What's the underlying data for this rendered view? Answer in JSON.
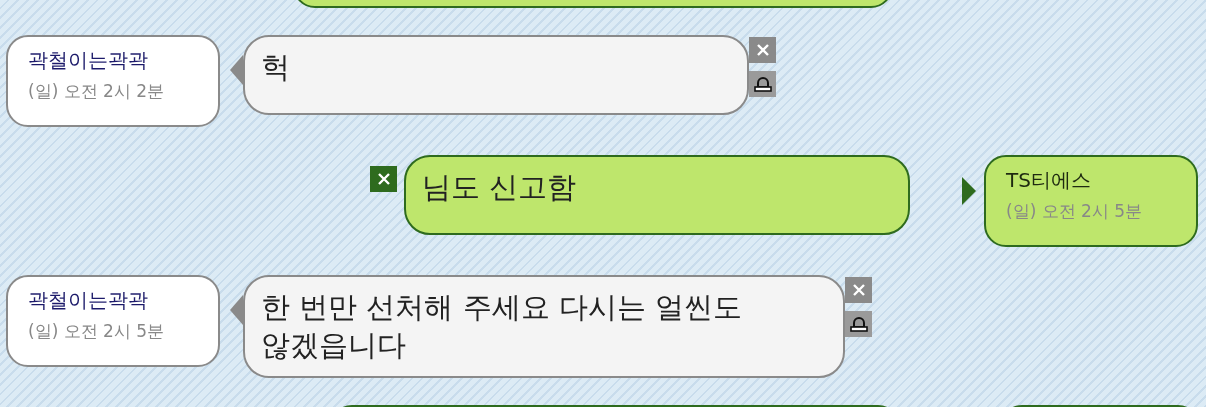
{
  "messages": [
    {
      "kind": "incoming",
      "sender": "곽철이는곽곽",
      "time": "(일) 오전 2시 2분",
      "text": "헉"
    },
    {
      "kind": "outgoing",
      "sender": "TS티에스",
      "time": "(일) 오전 2시 5분",
      "text": "님도 신고함"
    },
    {
      "kind": "incoming",
      "sender": "곽철이는곽곽",
      "time": "(일) 오전 2시 5분",
      "text": "한 번만 선처해 주세요 다시는 얼씬도 않겠읍니다"
    }
  ]
}
